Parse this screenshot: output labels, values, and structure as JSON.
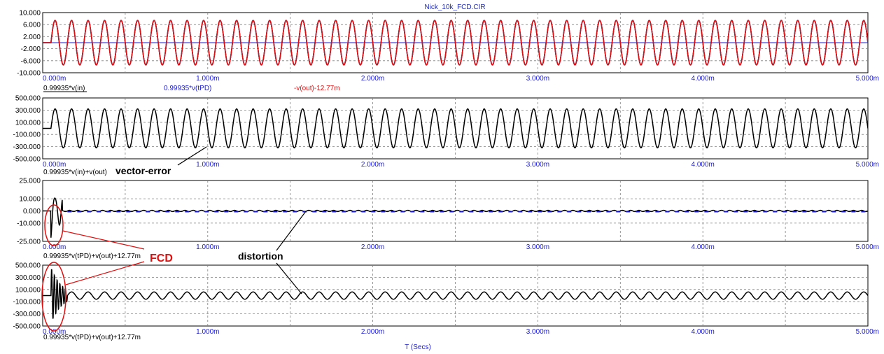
{
  "window": {
    "title": "Nick_10k_FCD.CIR"
  },
  "colors": {
    "red": "#e01010",
    "blue": "#1a1ad6",
    "black": "#000000",
    "grid": "#808080",
    "annotation_red": "#e01010"
  },
  "chart_data": [
    {
      "type": "line",
      "x_ticks": [
        "0.000m",
        "1.000m",
        "2.000m",
        "3.000m",
        "4.000m",
        "5.000m"
      ],
      "xlim": [
        0,
        5
      ],
      "y_ticks": [
        "10.000",
        "6.000",
        "2.000",
        "-2.000",
        "-6.000",
        "-10.000"
      ],
      "ylim": [
        -10,
        10
      ],
      "grid": true,
      "series": [
        {
          "name": "0.99935*v(in)",
          "color": "#000000",
          "kind": "sine",
          "amplitude": 7.4,
          "freq_khz": 10
        },
        {
          "name": "0.99935*v(tPD)",
          "color": "#1a1ad6",
          "kind": "sine",
          "amplitude": 7.4,
          "freq_khz": 10
        },
        {
          "name": "-v(out)-12.77m",
          "color": "#e01010",
          "kind": "sine",
          "amplitude": 7.4,
          "freq_khz": 10
        }
      ]
    },
    {
      "type": "line",
      "x_ticks": [
        "0.000m",
        "1.000m",
        "2.000m",
        "3.000m",
        "4.000m",
        "5.000m"
      ],
      "xlim": [
        0,
        5
      ],
      "y_ticks": [
        "500.000",
        "300.000",
        "100.000",
        "-100.000",
        "-300.000",
        "-500.000"
      ],
      "ylim": [
        -500,
        500
      ],
      "grid": true,
      "series": [
        {
          "name": "0.99935*v(in)+v(out)",
          "color": "#000000",
          "kind": "sine",
          "amplitude": 320,
          "freq_khz": 10
        }
      ]
    },
    {
      "type": "line",
      "x_ticks": [
        "0.000m",
        "1.000m",
        "2.000m",
        "3.000m",
        "4.000m",
        "5.000m"
      ],
      "xlim": [
        0,
        5
      ],
      "y_ticks": [
        "25.000",
        "10.000",
        "0.000",
        "-10.000",
        "-25.000"
      ],
      "ylim": [
        -25,
        25
      ],
      "grid": true,
      "series": [
        {
          "name": "0.99935*v(tPD)+v(out)+12.77m",
          "color": "#000000",
          "kind": "transient",
          "amplitude": 0.5,
          "freq_khz": 10
        }
      ]
    },
    {
      "type": "line",
      "x_ticks": [
        "0.000m",
        "1.000m",
        "2.000m",
        "3.000m",
        "4.000m",
        "5.000m"
      ],
      "xlim": [
        0,
        5
      ],
      "y_ticks": [
        "500.000",
        "300.000",
        "100.000",
        "-100.000",
        "-300.000",
        "-500.000"
      ],
      "ylim": [
        -500,
        500
      ],
      "grid": true,
      "xlabel": "T (Secs)",
      "series": [
        {
          "name": "0.99935*v(tPD)+v(out)+12.77m",
          "color": "#000000",
          "kind": "distortion",
          "amplitude": 60,
          "freq_khz": 10
        }
      ]
    }
  ],
  "annotations": {
    "vector_error": "vector-error",
    "fcd": "FCD",
    "distortion": "distortion"
  }
}
